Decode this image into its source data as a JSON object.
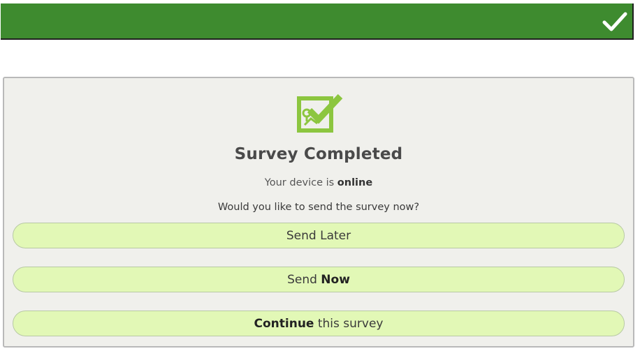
{
  "header": {
    "confirm_icon": "checkmark-icon",
    "bar_color": "#3e8b2f"
  },
  "dialog": {
    "icon": "survey-map-check-icon",
    "icon_color": "#8cc63f",
    "title": "Survey Completed",
    "status_prefix": "Your device is",
    "status_value": "online",
    "question": "Would you like to send the survey now?",
    "buttons": {
      "send_later": "Send Later",
      "send_now_prefix": "Send",
      "send_now_bold": "Now",
      "continue_bold": "Continue",
      "continue_suffix": "this survey"
    },
    "button_color": "#e2f8b6"
  }
}
